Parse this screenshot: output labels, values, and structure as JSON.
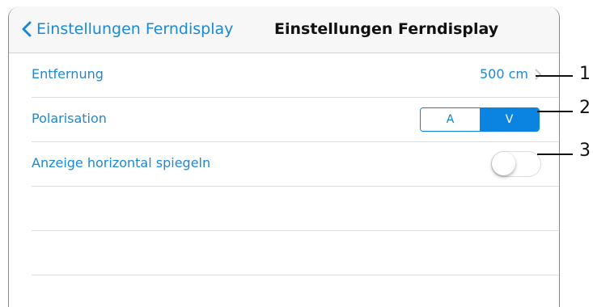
{
  "navbar": {
    "back_label": "Einstellungen Ferndisplay",
    "title": "Einstellungen Ferndisplay"
  },
  "rows": {
    "distance": {
      "label": "Entfernung",
      "value": "500 cm"
    },
    "polarisation": {
      "label": "Polarisation",
      "options": [
        "A",
        "V"
      ],
      "selected": "V"
    },
    "mirror": {
      "label": "Anzeige horizontal spiegeln",
      "enabled": false
    }
  },
  "callouts": [
    "1",
    "2",
    "3"
  ],
  "colors": {
    "accent": "#0a84e0",
    "label": "#1a8ad6"
  }
}
